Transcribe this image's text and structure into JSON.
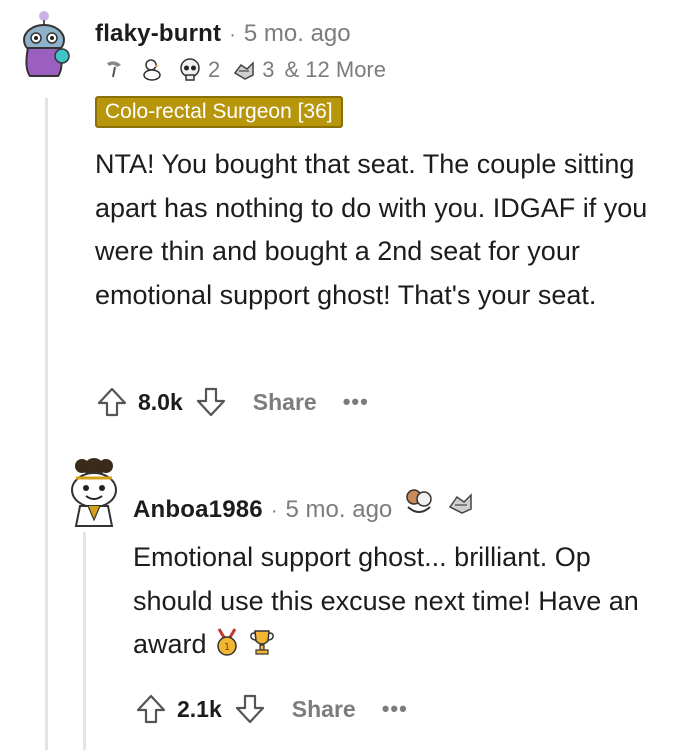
{
  "comments": [
    {
      "username": "flaky-burnt",
      "time": "5 mo. ago",
      "award_counts": [
        "2",
        "3"
      ],
      "more_awards": "& 12 More",
      "flair": "Colo-rectal Surgeon [36]",
      "body": "NTA! You bought that seat. The couple sitting apart has nothing to do with you. IDGAF if you were thin and bought a 2nd seat for your emotional support ghost! That's your seat.",
      "score": "8.0k",
      "share_label": "Share",
      "more_label": "•••"
    },
    {
      "username": "Anboa1986",
      "time": "5 mo. ago",
      "body": "Emotional support ghost... brilliant. Op should use this excuse next time! Have an award",
      "score": "2.1k",
      "share_label": "Share",
      "more_label": "•••"
    }
  ],
  "separator": "·",
  "colors": {
    "flair_bg": "#b8960c",
    "meta_gray": "#7c7c7c",
    "text": "#1c1c1c"
  },
  "icons": [
    "upvote-icon",
    "downvote-icon",
    "snoo-award-icon",
    "duck-award-icon",
    "skull-award-icon",
    "helpful-award-icon",
    "medal-award-icon",
    "trophy-award-icon",
    "hug-award-icon"
  ]
}
